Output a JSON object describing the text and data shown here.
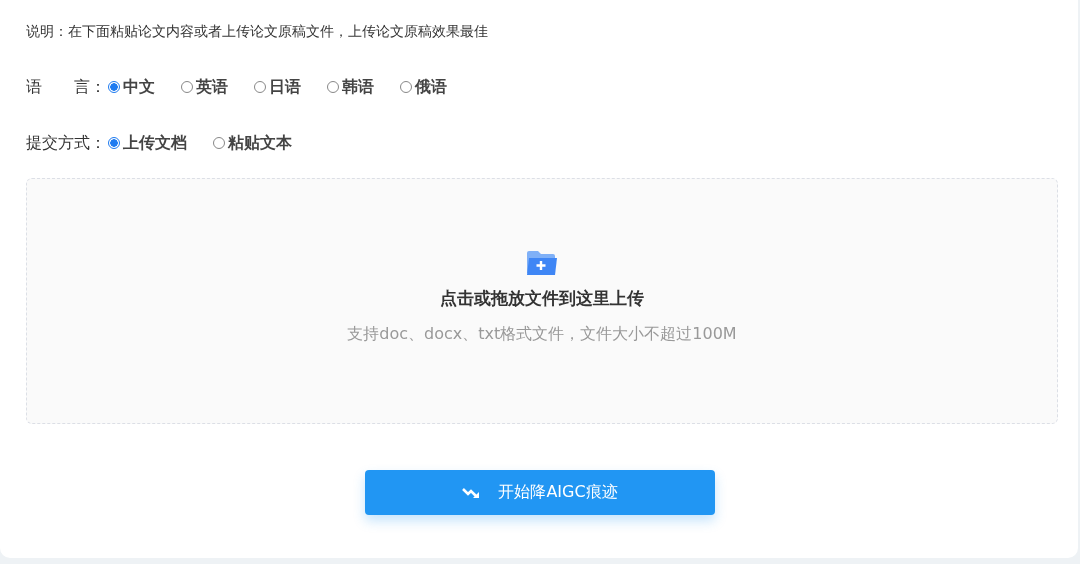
{
  "note": "说明：在下面粘贴论文内容或者上传论文原稿文件，上传论文原稿效果最佳",
  "language": {
    "label": "语　　言：",
    "options": [
      {
        "label": "中文",
        "selected": true
      },
      {
        "label": "英语",
        "selected": false
      },
      {
        "label": "日语",
        "selected": false
      },
      {
        "label": "韩语",
        "selected": false
      },
      {
        "label": "俄语",
        "selected": false
      }
    ]
  },
  "submit_mode": {
    "label": "提交方式：",
    "options": [
      {
        "label": "上传文档",
        "selected": true
      },
      {
        "label": "粘贴文本",
        "selected": false
      }
    ]
  },
  "upload": {
    "title": "点击或拖放文件到这里上传",
    "hint": "支持doc、docx、txt格式文件，文件大小不超过100M"
  },
  "start_button": "开始降AIGC痕迹"
}
